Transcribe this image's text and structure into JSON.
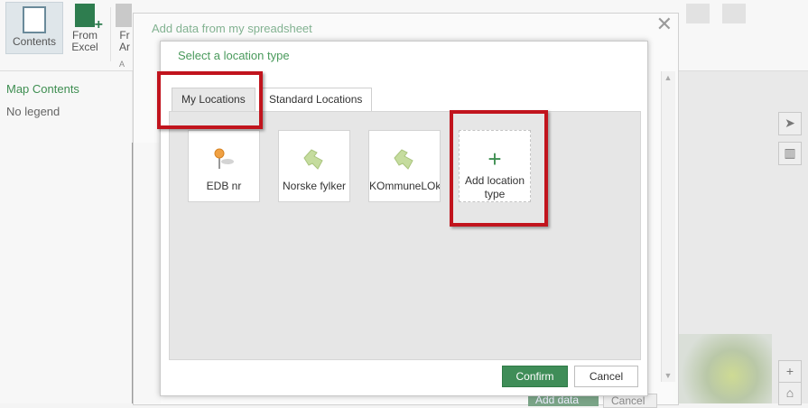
{
  "ribbon": {
    "contents_label": "Contents",
    "from_excel_label": "From\nExcel",
    "from_arc_label_fragment": "Fr\nAr",
    "group_label_fragment": "A"
  },
  "left_pane": {
    "title": "Map Contents",
    "empty_text": "No legend"
  },
  "outer_modal": {
    "title": "Add data from my spreadsheet",
    "close_glyph": "✕",
    "footer_buttons": [
      "Add data",
      "Cancel"
    ]
  },
  "dialog": {
    "title": "Select a location type",
    "tabs": [
      {
        "label": "My Locations",
        "active": true
      },
      {
        "label": "Standard Locations",
        "active": false
      }
    ],
    "tiles": [
      {
        "label": "EDB nr",
        "icon": "pin-icon"
      },
      {
        "label": "Norske fylker",
        "icon": "polygon-icon"
      },
      {
        "label": "KOmmuneLOk",
        "icon": "polygon-icon"
      }
    ],
    "add_tile": {
      "plus": "+",
      "label": "Add location type"
    },
    "confirm_label": "Confirm",
    "cancel_label": "Cancel"
  },
  "map_controls": {
    "zoom_in": "+",
    "home": "⌂"
  },
  "colors": {
    "accent_green": "#3f8d58",
    "title_green": "#4a9a5c",
    "highlight_red": "#c1141d",
    "polygon_green": "#c5dc9e"
  }
}
